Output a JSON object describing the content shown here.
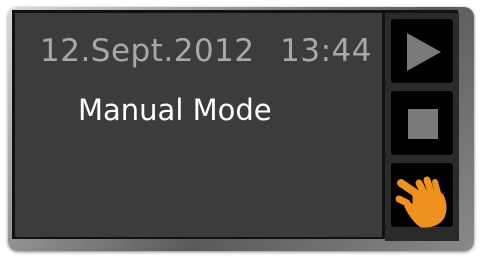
{
  "status": {
    "date": "12.Sept.2012",
    "time": "13:44"
  },
  "mode_label": "Manual Mode",
  "buttons": [
    {
      "name": "play",
      "icon": "play-icon"
    },
    {
      "name": "stop",
      "icon": "stop-icon"
    },
    {
      "name": "manual",
      "icon": "hand-pointer-icon",
      "active": true
    }
  ],
  "colors": {
    "screen_bg": "#3c3c3c",
    "date_text": "#a8a8a8",
    "mode_text": "#ffffff",
    "icon_gray": "#7a7a7a",
    "hand_orange": "#f0901e"
  }
}
